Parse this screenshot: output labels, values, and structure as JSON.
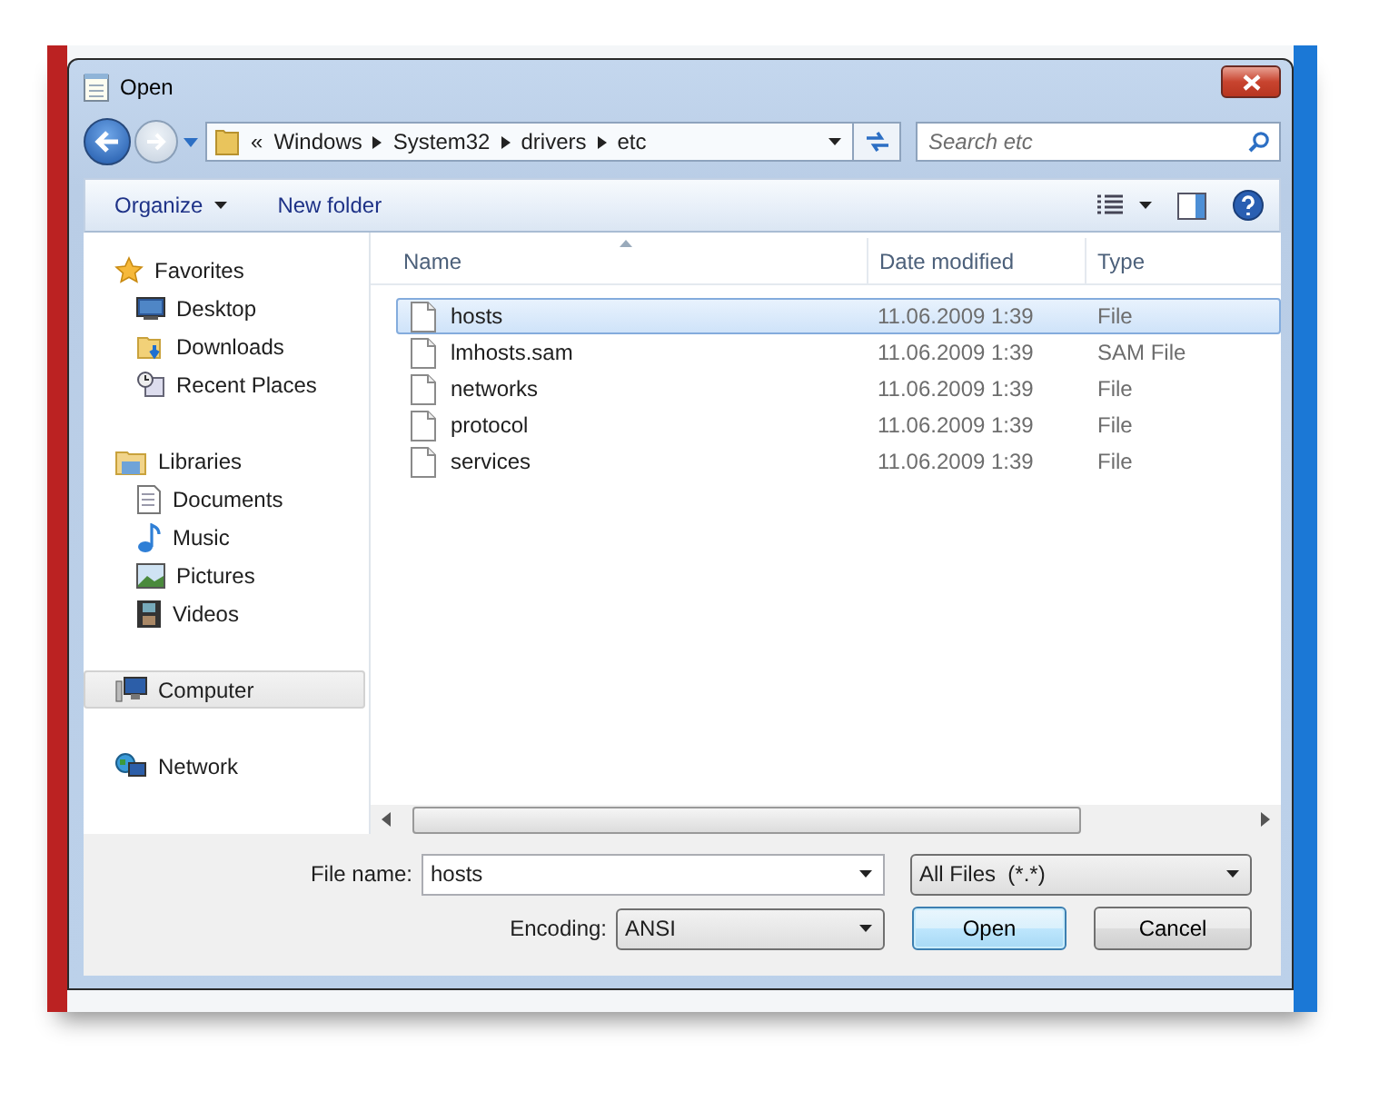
{
  "window": {
    "title": "Open"
  },
  "address_bar": {
    "crumbs": [
      "«",
      "Windows",
      "System32",
      "drivers",
      "etc"
    ]
  },
  "search": {
    "placeholder": "Search etc"
  },
  "toolbar": {
    "buttons": [
      {
        "label": "Organize",
        "dropdown": true
      },
      {
        "label": "New folder",
        "dropdown": false
      }
    ]
  },
  "sidebar": {
    "groups": [
      {
        "label": "Favorites",
        "kind": "star",
        "selected": false,
        "children": [
          {
            "label": "Desktop",
            "kind": "desktop",
            "selected": false
          },
          {
            "label": "Downloads",
            "kind": "downloads",
            "selected": false
          },
          {
            "label": "Recent Places",
            "kind": "recent",
            "selected": false
          }
        ]
      },
      {
        "label": "Libraries",
        "kind": "library",
        "selected": false,
        "children": [
          {
            "label": "Documents",
            "kind": "document",
            "selected": false
          },
          {
            "label": "Music",
            "kind": "music",
            "selected": false
          },
          {
            "label": "Pictures",
            "kind": "picture",
            "selected": false
          },
          {
            "label": "Videos",
            "kind": "video",
            "selected": false
          }
        ]
      },
      {
        "label": "Computer",
        "kind": "computer",
        "selected": true
      },
      {
        "label": "Network",
        "kind": "network",
        "selected": false
      }
    ]
  },
  "table": {
    "columns": [
      {
        "label": "Name",
        "sorted": true
      },
      {
        "label": "Date modified",
        "sorted": false
      },
      {
        "label": "Type",
        "sorted": false
      }
    ],
    "rows": [
      {
        "name": "hosts",
        "date": "11.06.2009 1:39",
        "type": "File",
        "selected": true
      },
      {
        "name": "lmhosts.sam",
        "date": "11.06.2009 1:39",
        "type": "SAM File",
        "selected": false
      },
      {
        "name": "networks",
        "date": "11.06.2009 1:39",
        "type": "File",
        "selected": false
      },
      {
        "name": "protocol",
        "date": "11.06.2009 1:39",
        "type": "File",
        "selected": false
      },
      {
        "name": "services",
        "date": "11.06.2009 1:39",
        "type": "File",
        "selected": false
      }
    ]
  },
  "footer": {
    "file_name": {
      "label": "File name:",
      "value": "hosts"
    },
    "filter": {
      "value": "All Files  (*.*)"
    },
    "encoding": {
      "label": "Encoding:",
      "value": "ANSI"
    },
    "buttons": [
      {
        "label": "Open",
        "default": true
      },
      {
        "label": "Cancel",
        "default": false
      }
    ]
  }
}
